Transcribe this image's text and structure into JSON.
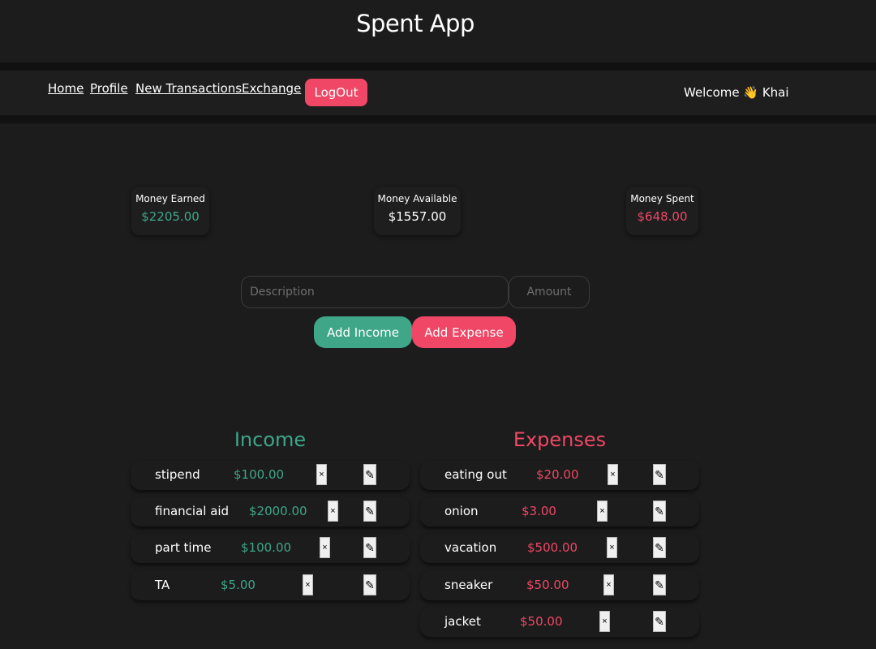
{
  "app": {
    "title": "Spent App"
  },
  "nav": {
    "links": [
      "Home",
      "Profile",
      "New Transactions",
      "Exchange"
    ],
    "logout_label": "LogOut",
    "welcome": "Welcome 👋 Khai"
  },
  "stats": {
    "earned": {
      "label": "Money Earned",
      "value": "$2205.00"
    },
    "available": {
      "label": "Money Available",
      "value": "$1557.00"
    },
    "spent": {
      "label": "Money Spent",
      "value": "$648.00"
    }
  },
  "form": {
    "description_placeholder": "Description",
    "amount_placeholder": "Amount",
    "add_income_label": "Add Income",
    "add_expense_label": "Add Expense"
  },
  "income": {
    "title": "Income",
    "items": [
      {
        "description": "stipend",
        "amount": "$100.00"
      },
      {
        "description": "financial aid",
        "amount": "$2000.00"
      },
      {
        "description": "part time",
        "amount": "$100.00"
      },
      {
        "description": "TA",
        "amount": "$5.00"
      }
    ]
  },
  "expenses": {
    "title": "Expenses",
    "items": [
      {
        "description": "eating out",
        "amount": "$20.00"
      },
      {
        "description": "onion",
        "amount": "$3.00"
      },
      {
        "description": "vacation",
        "amount": "$500.00"
      },
      {
        "description": "sneaker",
        "amount": "$50.00"
      },
      {
        "description": "jacket",
        "amount": "$50.00"
      }
    ]
  },
  "icons": {
    "delete": "×",
    "edit": "✎"
  },
  "colors": {
    "income": "#3fa688",
    "expense": "#ef4765",
    "background": "#1c1c1c"
  }
}
